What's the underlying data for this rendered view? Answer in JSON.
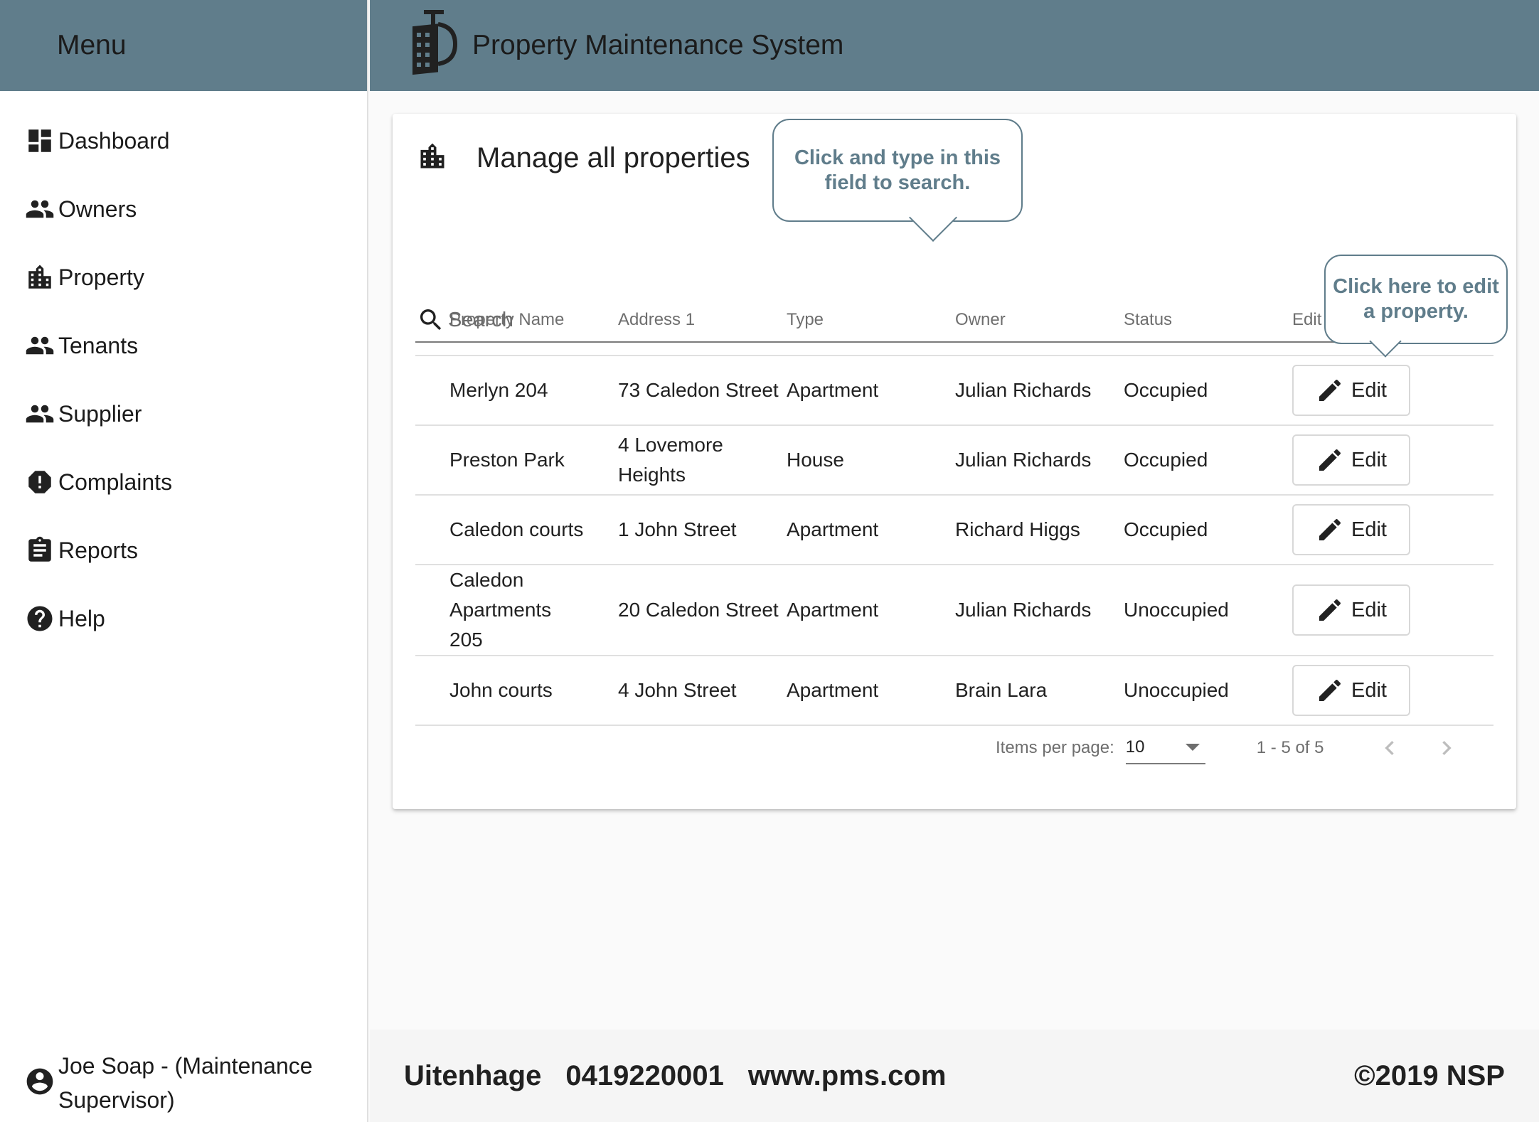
{
  "sidebar": {
    "title": "Menu",
    "items": [
      {
        "label": "Dashboard",
        "icon": "dashboard-icon"
      },
      {
        "label": "Owners",
        "icon": "people-icon"
      },
      {
        "label": "Property",
        "icon": "building-icon"
      },
      {
        "label": "Tenants",
        "icon": "people-icon"
      },
      {
        "label": "Supplier",
        "icon": "people-icon"
      },
      {
        "label": "Complaints",
        "icon": "alert-icon"
      },
      {
        "label": "Reports",
        "icon": "clipboard-icon"
      },
      {
        "label": "Help",
        "icon": "help-icon"
      }
    ],
    "user": "Joe Soap - (Maintenance Supervisor)"
  },
  "header": {
    "title": "Property Maintenance System",
    "logo_icon": "property-logo-icon"
  },
  "main": {
    "title": "Manage all properties",
    "search": {
      "placeholder": "Search",
      "value": ""
    },
    "tooltips": {
      "search": "Click and type in this field to search.",
      "edit": "Click here to edit a property."
    },
    "columns": [
      "Property Name",
      "Address 1",
      "Type",
      "Owner",
      "Status",
      "Edit"
    ],
    "rows": [
      {
        "name": "Merlyn 204",
        "address": "73 Caledon Street",
        "type": "Apartment",
        "owner": "Julian Richards",
        "status": "Occupied",
        "edit": "Edit"
      },
      {
        "name": "Preston Park",
        "address": "4 Lovemore Heights",
        "type": "House",
        "owner": "Julian Richards",
        "status": "Occupied",
        "edit": "Edit"
      },
      {
        "name": "Caledon courts",
        "address": "1 John Street",
        "type": "Apartment",
        "owner": "Richard Higgs",
        "status": "Occupied",
        "edit": "Edit"
      },
      {
        "name": "Caledon Apartments 205",
        "address": "20 Caledon Street",
        "type": "Apartment",
        "owner": "Julian Richards",
        "status": "Unoccupied",
        "edit": "Edit"
      },
      {
        "name": "John courts",
        "address": "4 John Street",
        "type": "Apartment",
        "owner": "Brain Lara",
        "status": "Unoccupied",
        "edit": "Edit"
      }
    ],
    "paginator": {
      "items_per_page_label": "Items per page:",
      "items_per_page": "10",
      "range": "1 - 5 of 5"
    }
  },
  "footer": {
    "city": "Uitenhage",
    "phone": "0419220001",
    "website": "www.pms.com",
    "copyright": "©2019 NSP"
  },
  "colors": {
    "header_bg": "#607d8b",
    "tooltip": "#607d8b",
    "page_bg": "#fafafa"
  }
}
